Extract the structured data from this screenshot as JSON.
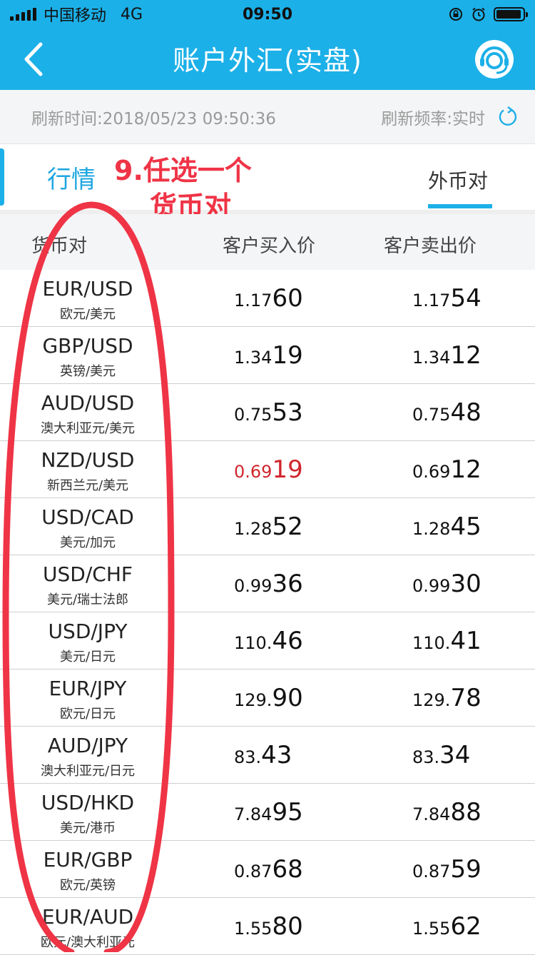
{
  "status": {
    "carrier": "中国移动",
    "network": "4G",
    "time": "09:50"
  },
  "nav": {
    "title": "账户外汇(实盘)",
    "back_icon": "chevron-left-icon",
    "service_icon": "customer-service-icon"
  },
  "refresh": {
    "time_label": "刷新时间:2018/05/23 09:50:36",
    "rate_label": "刷新频率:实时"
  },
  "tabs": {
    "market": "行情",
    "pairs": "外币对"
  },
  "annotation": {
    "line1": "9.任选一个",
    "line2": "货币对"
  },
  "table": {
    "headers": {
      "pair": "货币对",
      "buy": "客户买入价",
      "sell": "客户卖出价"
    },
    "rows": [
      {
        "code": "EUR/USD",
        "name": "欧元/美元",
        "buy_small": "1.17",
        "buy_big": "60",
        "sell_small": "1.17",
        "sell_big": "54",
        "highlight": false
      },
      {
        "code": "GBP/USD",
        "name": "英镑/美元",
        "buy_small": "1.34",
        "buy_big": "19",
        "sell_small": "1.34",
        "sell_big": "12",
        "highlight": false
      },
      {
        "code": "AUD/USD",
        "name": "澳大利亚元/美元",
        "buy_small": "0.75",
        "buy_big": "53",
        "sell_small": "0.75",
        "sell_big": "48",
        "highlight": false
      },
      {
        "code": "NZD/USD",
        "name": "新西兰元/美元",
        "buy_small": "0.69",
        "buy_big": "19",
        "sell_small": "0.69",
        "sell_big": "12",
        "highlight": true
      },
      {
        "code": "USD/CAD",
        "name": "美元/加元",
        "buy_small": "1.28",
        "buy_big": "52",
        "sell_small": "1.28",
        "sell_big": "45",
        "highlight": false
      },
      {
        "code": "USD/CHF",
        "name": "美元/瑞士法郎",
        "buy_small": "0.99",
        "buy_big": "36",
        "sell_small": "0.99",
        "sell_big": "30",
        "highlight": false
      },
      {
        "code": "USD/JPY",
        "name": "美元/日元",
        "buy_small": "110.",
        "buy_big": "46",
        "sell_small": "110.",
        "sell_big": "41",
        "highlight": false
      },
      {
        "code": "EUR/JPY",
        "name": "欧元/日元",
        "buy_small": "129.",
        "buy_big": "90",
        "sell_small": "129.",
        "sell_big": "78",
        "highlight": false
      },
      {
        "code": "AUD/JPY",
        "name": "澳大利亚元/日元",
        "buy_small": "83.",
        "buy_big": "43",
        "sell_small": "83.",
        "sell_big": "34",
        "highlight": false
      },
      {
        "code": "USD/HKD",
        "name": "美元/港币",
        "buy_small": "7.84",
        "buy_big": "95",
        "sell_small": "7.84",
        "sell_big": "88",
        "highlight": false
      },
      {
        "code": "EUR/GBP",
        "name": "欧元/英镑",
        "buy_small": "0.87",
        "buy_big": "68",
        "sell_small": "0.87",
        "sell_big": "59",
        "highlight": false
      },
      {
        "code": "EUR/AUD",
        "name": "欧元/澳大利亚元",
        "buy_small": "1.55",
        "buy_big": "80",
        "sell_small": "1.55",
        "sell_big": "62",
        "highlight": false
      }
    ]
  },
  "colors": {
    "brand_blue": "#1cb0e8",
    "annotation_red": "#ef3446",
    "price_up_red": "#d0262d"
  }
}
